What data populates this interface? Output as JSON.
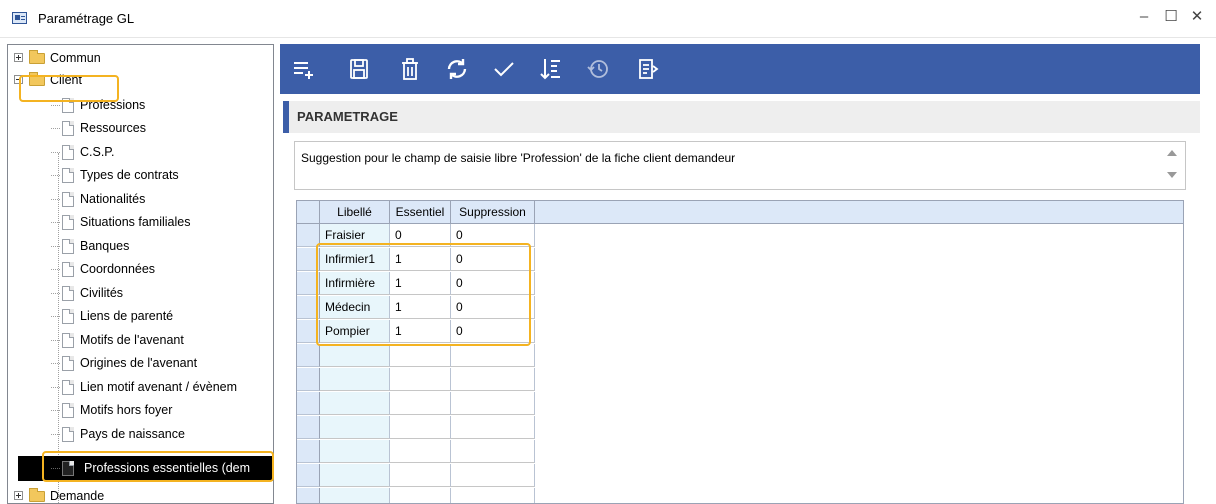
{
  "window": {
    "title": "Paramétrage GL",
    "controls": {
      "minimize": "–",
      "maximize": "☐",
      "close": "✕"
    }
  },
  "tree": {
    "items": [
      {
        "label": "Commun",
        "type": "folder",
        "expander": "plus"
      },
      {
        "label": "Client",
        "type": "folder",
        "expander": "minus",
        "highlighted": true
      },
      {
        "label": "Professions",
        "type": "doc"
      },
      {
        "label": "Ressources",
        "type": "doc"
      },
      {
        "label": "C.S.P.",
        "type": "doc"
      },
      {
        "label": "Types de contrats",
        "type": "doc"
      },
      {
        "label": "Nationalités",
        "type": "doc"
      },
      {
        "label": "Situations familiales",
        "type": "doc"
      },
      {
        "label": "Banques",
        "type": "doc"
      },
      {
        "label": "Coordonnées",
        "type": "doc"
      },
      {
        "label": "Civilités",
        "type": "doc"
      },
      {
        "label": "Liens de parenté",
        "type": "doc"
      },
      {
        "label": "Motifs de l'avenant",
        "type": "doc"
      },
      {
        "label": "Origines de l'avenant",
        "type": "doc"
      },
      {
        "label": "Lien motif avenant / évènem",
        "type": "doc"
      },
      {
        "label": "Motifs hors foyer",
        "type": "doc"
      },
      {
        "label": "Pays de naissance",
        "type": "doc"
      },
      {
        "label": "Professions essentielles (dem",
        "type": "doc",
        "selected": true,
        "highlighted": true
      },
      {
        "label": "Demande",
        "type": "folder",
        "expander": "plus"
      }
    ]
  },
  "toolbar": {
    "buttons": [
      {
        "name": "add-row",
        "icon": "add-list-icon"
      },
      {
        "name": "save",
        "icon": "save-icon"
      },
      {
        "name": "delete",
        "icon": "trash-icon"
      },
      {
        "name": "refresh",
        "icon": "refresh-icon"
      },
      {
        "name": "validate",
        "icon": "check-icon"
      },
      {
        "name": "sort",
        "icon": "sort-icon"
      },
      {
        "name": "history",
        "icon": "history-icon"
      },
      {
        "name": "export",
        "icon": "export-icon"
      }
    ],
    "color": "#3c5ea8"
  },
  "section": {
    "title": "PARAMETRAGE",
    "description": "Suggestion pour le champ de saisie libre 'Profession' de la fiche client demandeur"
  },
  "grid": {
    "columns": [
      "Libellé",
      "Essentiel",
      "Suppression"
    ],
    "rows": [
      [
        "Fraisier",
        "0",
        "0"
      ],
      [
        "Infirmier1",
        "1",
        "0"
      ],
      [
        "Infirmière",
        "1",
        "0"
      ],
      [
        "Médecin",
        "1",
        "0"
      ],
      [
        "Pompier",
        "1",
        "0"
      ]
    ],
    "empty_rows": 7
  },
  "colors": {
    "highlight": "#f4b321",
    "accent": "#3c5ea8",
    "selection": "#000000"
  }
}
